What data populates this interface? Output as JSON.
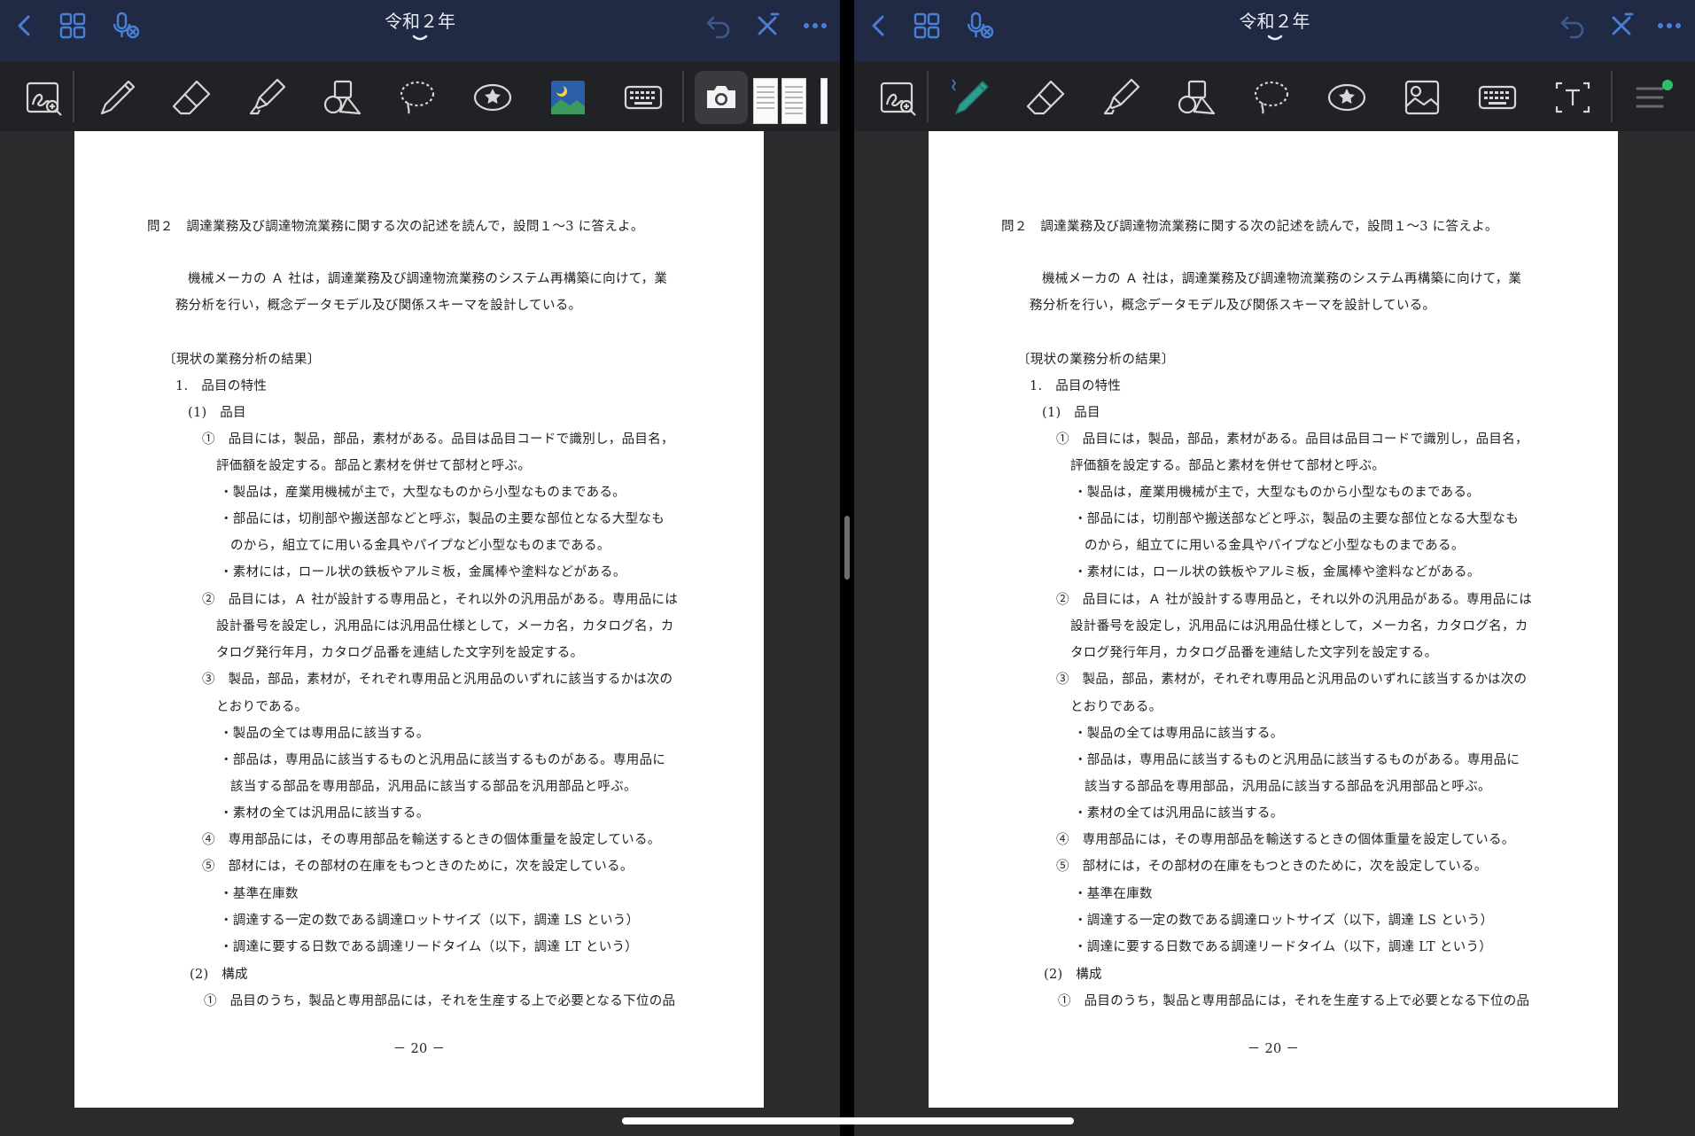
{
  "app": {
    "document_title": "令和２年",
    "icons": {
      "back": "chevron-left-icon",
      "grid": "grid-icon",
      "mic": "mic-muted-icon",
      "undo": "undo-icon",
      "close": "close-pen-icon",
      "more": "more-icon"
    }
  },
  "toolbar_left": [
    "lasso-zoom",
    "pen",
    "eraser",
    "highlighter",
    "shapes",
    "lasso",
    "sticker",
    "image",
    "keyboard",
    "camera"
  ],
  "toolbar_right": [
    "lasso-zoom",
    "pen",
    "eraser",
    "highlighter",
    "shapes",
    "lasso",
    "sticker",
    "image",
    "keyboard",
    "text-box",
    "menu"
  ],
  "document": {
    "question": "問２　調達業務及び調達物流業務に関する次の記述を読んで，設問１～3 に答えよ。",
    "intro_1": "機械メーカの Ａ 社は，調達業務及び調達物流業務のシステム再構築に向けて，業",
    "intro_2": "務分析を行い，概念データモデル及び関係スキーマを設計している。",
    "section": "〔現状の業務分析の結果〕",
    "item_1": "1.　品目の特性",
    "sub_1": "(1)　品目",
    "c1_a": "①　品目には，製品，部品，素材がある。品目は品目コードで識別し，品目名，",
    "c1_b": "評価額を設定する。部品と素材を併せて部材と呼ぶ。",
    "b1": "・製品は，産業用機械が主で，大型なものから小型なものまである。",
    "b2_a": "・部品には，切削部や搬送部などと呼ぶ，製品の主要な部位となる大型なも",
    "b2_b": "のから，組立てに用いる金具やパイプなど小型なものまである。",
    "b3": "・素材には，ロール状の鉄板やアルミ板，金属棒や塗料などがある。",
    "c2_a": "②　品目には，Ａ 社が設計する専用品と，それ以外の汎用品がある。専用品には",
    "c2_b": "設計番号を設定し，汎用品には汎用品仕様として，メーカ名，カタログ名，カ",
    "c2_c": "タログ発行年月，カタログ品番を連結した文字列を設定する。",
    "c3_a": "③　製品，部品，素材が，それぞれ専用品と汎用品のいずれに該当するかは次の",
    "c3_b": "とおりである。",
    "b4": "・製品の全ては専用品に該当する。",
    "b5_a": "・部品は，専用品に該当するものと汎用品に該当するものがある。専用品に",
    "b5_b": "該当する部品を専用部品，汎用品に該当する部品を汎用部品と呼ぶ。",
    "b6": "・素材の全ては汎用品に該当する。",
    "c4": "④　専用部品には，その専用部品を輸送するときの個体重量を設定している。",
    "c5": "⑤　部材には，その部材の在庫をもつときのために，次を設定している。",
    "b7": "・基準在庫数",
    "b8": "・調達する一定の数である調達ロットサイズ（以下，調達 LS という）",
    "b9": "・調達に要する日数である調達リードタイム（以下，調達 LT という）",
    "sub_2": "(2)　構成",
    "c6": "①　品目のうち，製品と専用部品には，それを生産する上で必要となる下位の品",
    "page_number": "－ 20 －"
  },
  "colors": {
    "navbar": "#212a44",
    "toolbar": "#202226",
    "accent": "#4a7fd6",
    "active_pen": "#2f9c8f"
  }
}
